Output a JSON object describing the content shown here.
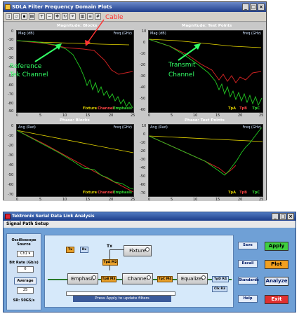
{
  "window1": {
    "title": "SDLA Filter Frequency Domain Plots",
    "annotations": {
      "cable": "Cable",
      "reference": "Reference",
      "tektronix_channel": "Tek Channel",
      "transmit": "Transmit",
      "channel": "Channel"
    },
    "panels": [
      {
        "title": "Magnitude: Blocks",
        "y_label": "Mag (dB)",
        "x_label": "Freq (GHz)",
        "y_ticks": [
          "0",
          "-10",
          "-20",
          "-30",
          "-40",
          "-50",
          "-60",
          "-70",
          "-80",
          "-90"
        ],
        "x_ticks": [
          "0",
          "5",
          "10",
          "15",
          "20",
          "25"
        ],
        "legend": [
          "Fixture",
          "Channel",
          "Emphasis"
        ]
      },
      {
        "title": "Magnitude: Test Points",
        "y_label": "Mag (dB)",
        "x_label": "Freq (GHz)",
        "y_ticks": [
          "10",
          "0",
          "-10",
          "-20",
          "-30",
          "-40",
          "-50",
          "-60"
        ],
        "x_ticks": [
          "0",
          "5",
          "10",
          "15",
          "20",
          "25"
        ],
        "legend": [
          "TpA",
          "TpB",
          "TpC"
        ]
      },
      {
        "title": "Phase: Blocks",
        "y_label": "Ang (Rad)",
        "x_label": "Freq (GHz)",
        "y_ticks": [
          "0",
          "-10",
          "-20",
          "-30",
          "-40",
          "-50",
          "-60",
          "-70"
        ],
        "x_ticks": [
          "0",
          "5",
          "10",
          "15",
          "20",
          "25"
        ],
        "legend": [
          "Fixture",
          "Channel",
          "Emphasis"
        ]
      },
      {
        "title": "Phase: Test Points",
        "y_label": "Ang (Rad)",
        "x_label": "Freq (GHz)",
        "y_ticks": [
          "10",
          "0",
          "-10",
          "-20",
          "-30",
          "-40",
          "-50",
          "-60",
          "-70"
        ],
        "x_ticks": [
          "0",
          "5",
          "10",
          "15",
          "20",
          "25"
        ],
        "legend": [
          "TpA",
          "TpB",
          "TpC"
        ]
      }
    ]
  },
  "window2": {
    "title": "Tektronix Serial Data Link Analysis",
    "section": "Signal Path Setup",
    "left": {
      "source_label": "Oscilloscope Source",
      "source_value": "Ch1",
      "bitrate_label": "Bit Rate (Gb/s)",
      "bitrate_value": "6",
      "average_button": "Average",
      "average_value": "25",
      "sample_rate": "SR: 50GS/s"
    },
    "diagram": {
      "tx_a": "Tx",
      "rx": "Rx",
      "tx_b": "Tx",
      "fixture": "Fixture",
      "emphasis": "Emphasis",
      "channel": "Channel",
      "equalizer": "Equalizer",
      "tp_m2": "TpA M2",
      "tp_m3": "TpB M3",
      "tp_m4": "TpC M4",
      "tp_r4": "TpD R4",
      "clk_r3": "Clk R3",
      "status": "Press Apply to update filters"
    },
    "buttons": {
      "save": "Save",
      "recall": "Recall",
      "standards": "Standards",
      "help": "Help",
      "apply": "Apply",
      "plot": "Plot",
      "analyze": "Analyze",
      "exit": "Exit"
    }
  },
  "colors": {
    "trace_green": "#22cc22",
    "trace_red": "#cc2222",
    "trace_yellow": "#e8d800",
    "annotation_red": "#ff3333",
    "annotation_green": "#33ff66"
  }
}
